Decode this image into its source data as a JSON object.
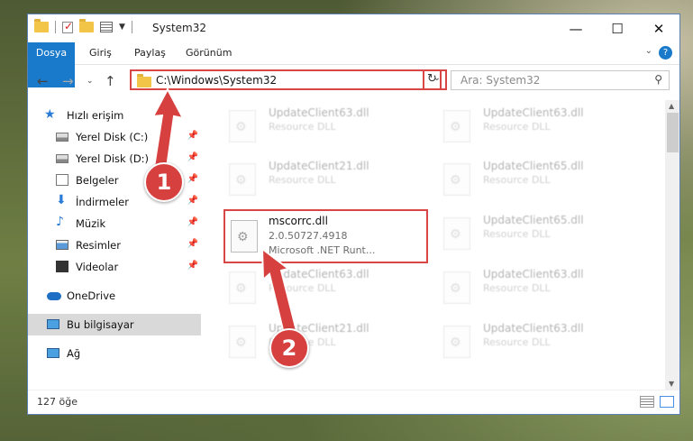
{
  "window": {
    "title": "System32"
  },
  "ribbon": {
    "tabs": [
      "Dosya",
      "Giriş",
      "Paylaş",
      "Görünüm"
    ]
  },
  "address": {
    "path": "C:\\Windows\\System32"
  },
  "search": {
    "placeholder": "Ara: System32"
  },
  "sidebar": {
    "items": [
      {
        "label": "Hızlı erişim",
        "icon": "star-icon"
      },
      {
        "label": "Yerel Disk (C:)",
        "icon": "drive-icon",
        "pinned": true
      },
      {
        "label": "Yerel Disk (D:)",
        "icon": "drive-icon",
        "pinned": true
      },
      {
        "label": "Belgeler",
        "icon": "document-icon",
        "pinned": true
      },
      {
        "label": "İndirmeler",
        "icon": "download-icon",
        "pinned": true
      },
      {
        "label": "Müzik",
        "icon": "music-icon",
        "pinned": true
      },
      {
        "label": "Resimler",
        "icon": "pictures-icon",
        "pinned": true
      },
      {
        "label": "Videolar",
        "icon": "video-icon",
        "pinned": true
      },
      {
        "label": "OneDrive",
        "icon": "cloud-icon"
      },
      {
        "label": "Bu bilgisayar",
        "icon": "computer-icon",
        "selected": true
      },
      {
        "label": "Ağ",
        "icon": "network-icon"
      }
    ]
  },
  "files": [
    {
      "name": "UpdateClient63.dll",
      "type": "Resource DLL"
    },
    {
      "name": "UpdateClient63.dll",
      "type": "Resource DLL"
    },
    {
      "name": "UpdateClient21.dll",
      "type": "Resource DLL"
    },
    {
      "name": "UpdateClient65.dll",
      "type": "Resource DLL"
    },
    {
      "name": "mscorrc.dll",
      "version": "2.0.50727.4918",
      "description": "Microsoft .NET Runt...",
      "highlighted": true
    },
    {
      "name": "UpdateClient65.dll",
      "type": "Resource DLL"
    },
    {
      "name": "UpdateClient63.dll",
      "type": "Resource DLL"
    },
    {
      "name": "UpdateClient63.dll",
      "type": "Resource DLL"
    },
    {
      "name": "UpdateClient21.dll",
      "type": "Resource DLL"
    },
    {
      "name": "UpdateClient63.dll",
      "type": "Resource DLL"
    }
  ],
  "status": {
    "count": "127 öğe"
  },
  "annotations": {
    "step1": "1",
    "step2": "2",
    "color": "#d6413f"
  },
  "colors": {
    "accent": "#1979ca",
    "highlight": "#d94646"
  }
}
